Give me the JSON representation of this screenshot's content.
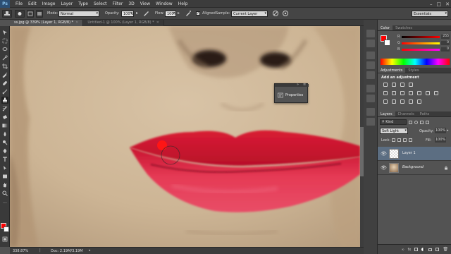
{
  "app": {
    "logo": "Ps"
  },
  "menu": [
    "File",
    "Edit",
    "Image",
    "Layer",
    "Type",
    "Select",
    "Filter",
    "3D",
    "View",
    "Window",
    "Help"
  ],
  "window_controls": [
    "–",
    "□",
    "✕"
  ],
  "options": {
    "mode_label": "Mode:",
    "mode_value": "Normal",
    "opacity_label": "Opacity:",
    "opacity_value": "100%",
    "flow_label": "Flow:",
    "flow_value": "100%",
    "aligned_label": "Aligned",
    "sample_label": "Sample:",
    "sample_value": "Current Layer",
    "workspace": "Essentials"
  },
  "tabs": [
    {
      "label": "ss.jpg @ 339% (Layer 1, RGB/8) *",
      "active": true
    },
    {
      "label": "Untitled-1 @ 100% (Layer 1, RGB/8) *",
      "active": false
    }
  ],
  "status": {
    "zoom": "338.87%",
    "doc": "Doc: 2.19M/3.19M"
  },
  "properties_float": {
    "label": "Properties"
  },
  "color_panel": {
    "tabs": [
      "Color",
      "Swatches"
    ],
    "channels": [
      {
        "name": "R",
        "value": "255"
      },
      {
        "name": "G",
        "value": "0"
      },
      {
        "name": "B",
        "value": "0"
      }
    ],
    "foreground": "#ff0000"
  },
  "adjustments_panel": {
    "tabs": [
      "Adjustments",
      "Styles"
    ],
    "heading": "Add an adjustment"
  },
  "layers_panel": {
    "tabs": [
      "Layers",
      "Channels",
      "Paths"
    ],
    "kind_label": "Kind",
    "blend_mode": "Soft Light",
    "opacity_label": "Opacity:",
    "opacity_value": "100%",
    "lock_label": "Lock:",
    "fill_label": "Fill:",
    "fill_value": "100%",
    "layers": [
      {
        "name": "Layer 1",
        "selected": true
      },
      {
        "name": "Background",
        "selected": false
      }
    ]
  },
  "colors": {
    "accent_red": "#ff0000",
    "lip": "#e0283a",
    "panel": "#535353"
  }
}
